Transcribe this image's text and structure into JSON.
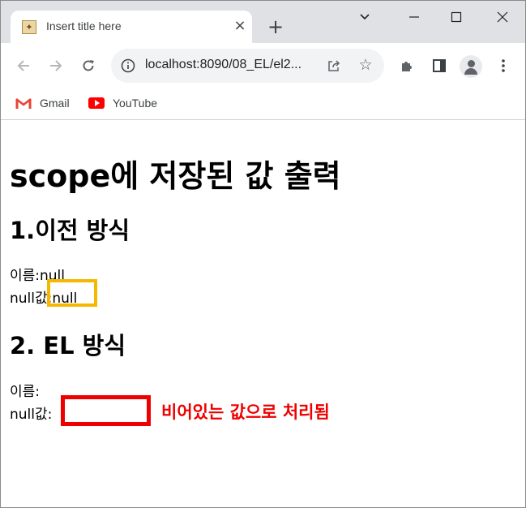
{
  "browser": {
    "tab_title": "Insert title here",
    "tab_close": "×",
    "new_tab": "+",
    "window_controls": {
      "minimize": "⌄",
      "maximize": "☐",
      "restore": "—",
      "close": "✕"
    },
    "url": "localhost:8090/08_EL/el2...",
    "bookmarks": [
      {
        "label": "Gmail",
        "icon": "gmail-icon"
      },
      {
        "label": "YouTube",
        "icon": "youtube-icon"
      }
    ]
  },
  "page": {
    "title": "scope에 저장된 값 출력",
    "section1": {
      "heading": "1.이전 방식",
      "name_line": "이름:null",
      "null_label": "null값",
      "null_value": ":null"
    },
    "section2": {
      "heading": "2. EL 방식",
      "name_line": "이름:",
      "null_label": "null값:"
    },
    "annotation": "비어있는 값으로 처리됨",
    "colors": {
      "highlight_yellow": "#f5b800",
      "highlight_red": "#ee0000"
    }
  }
}
